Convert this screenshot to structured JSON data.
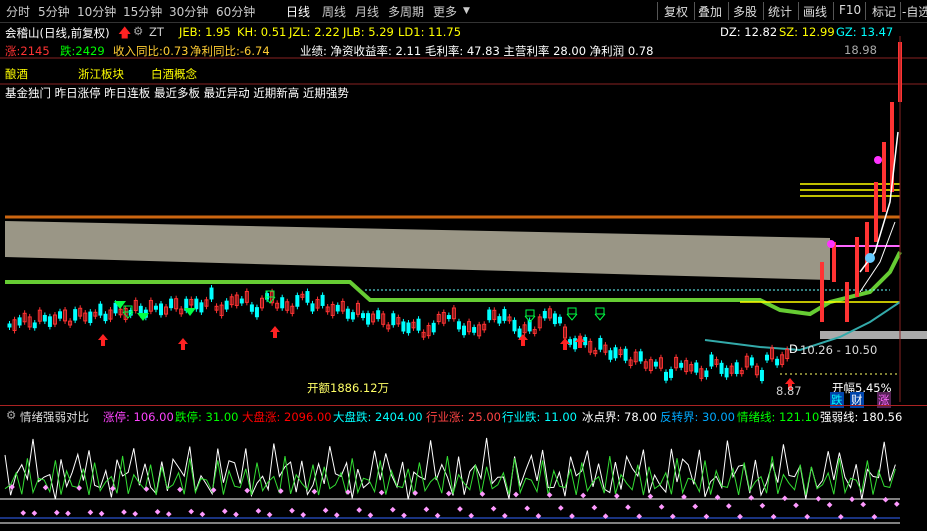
{
  "toolbar": {
    "periods": [
      "分时",
      "5分钟",
      "10分钟",
      "15分钟",
      "30分钟",
      "60分钟",
      "日线",
      "周线",
      "月线",
      "多周期",
      "更多"
    ],
    "selected": "日线",
    "right_buttons": [
      "复权",
      "叠加",
      "多股",
      "统计",
      "画线",
      "F10",
      "标记",
      "-自选"
    ]
  },
  "stock": {
    "name": "会稽山(日线,前复权)",
    "zt": "ZT",
    "indicators": [
      {
        "label": "JEB: 1.95",
        "color": "#ffff00"
      },
      {
        "label": "KH: 0.51",
        "color": "#ffff00"
      },
      {
        "label": "JZL: 2.22",
        "color": "#ffff00"
      },
      {
        "label": "JLB: 5.29",
        "color": "#ffff00"
      },
      {
        "label": "LD1: 11.75",
        "color": "#ffff00"
      }
    ],
    "dz": "DZ: 12.82",
    "sz": "SZ: 12.99",
    "gz": "GZ: 13.47"
  },
  "info": {
    "zhang": "涨:2145",
    "die": "跌:2429",
    "income": "收入同比:0.73",
    "profit": "净利同比:-6.74",
    "performance": "业绩:  净资收益率: 2.11 毛利率: 47.83 主营利率 28.00 净利润 0.78"
  },
  "concepts": {
    "a": "酿酒",
    "b": "浙江板块",
    "c": "白酒概念",
    "tags": "基金独门 昨日涨停 昨日连板 最近多板 最近异动 近期新高 近期强势"
  },
  "labels": {
    "high": "18.98",
    "range": "10.26 - 10.50",
    "low": "8.87",
    "amount": "开额1886.12万",
    "open_pct": "开幅5.45%",
    "d_mark": "D",
    "die_badge": "跌",
    "cai_badge": "财",
    "zhang_badge": "涨"
  },
  "sub": {
    "title": "情绪强弱对比",
    "items": [
      {
        "label": "涨停: 106.00",
        "color": "#ff44ff"
      },
      {
        "label": "跌停: 31.00",
        "color": "#00ff00"
      },
      {
        "label": "大盘涨: 2096.00",
        "color": "#ff0000"
      },
      {
        "label": "大盘跌: 2404.00",
        "color": "#00ffff"
      },
      {
        "label": "行业涨: 25.00",
        "color": "#ff4444"
      },
      {
        "label": "行业跌: 11.00",
        "color": "#00ffff"
      },
      {
        "label": "冰点界: 78.00",
        "color": "#ffffff"
      },
      {
        "label": "反转界: 30.00",
        "color": "#00aaff"
      },
      {
        "label": "情绪线: 121.10",
        "color": "#00ff00"
      },
      {
        "label": "强弱线: 180.56",
        "color": "#ffffff"
      }
    ]
  },
  "colors": {
    "up": "#ff3333",
    "down": "#00ffff",
    "band": "#9a9686",
    "orange": "#cc6611",
    "green": "#66cc33"
  }
}
